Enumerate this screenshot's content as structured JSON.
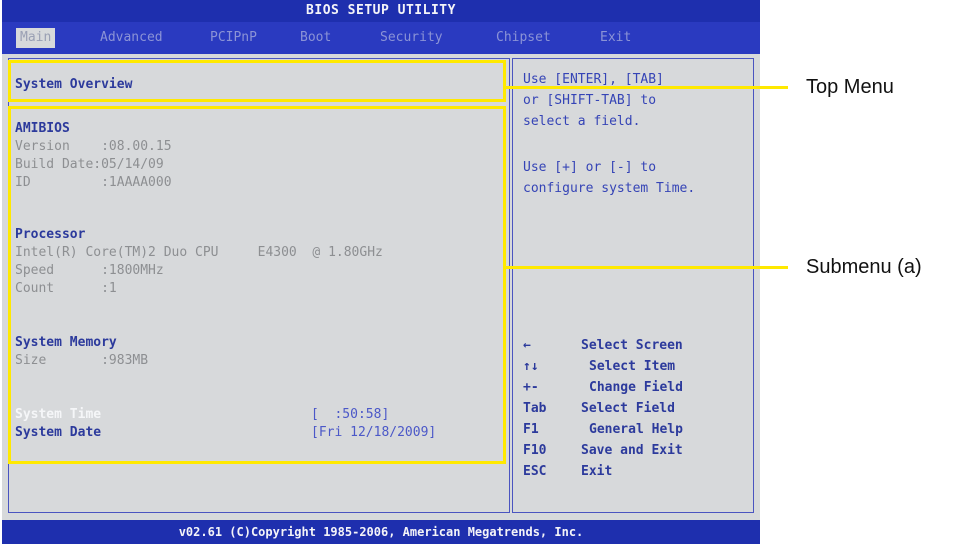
{
  "title": "BIOS SETUP UTILITY",
  "menu": {
    "items": [
      "Main",
      "Advanced",
      "PCIPnP",
      "Boot",
      "Security",
      "Chipset",
      "Exit"
    ]
  },
  "overview_header": "System Overview",
  "amibios": {
    "label": "AMIBIOS",
    "version": "Version    :08.00.15",
    "build_date": "Build Date:05/14/09",
    "id": "ID         :1AAAA000"
  },
  "processor": {
    "label": "Processor",
    "cpu": "Intel(R) Core(TM)2 Duo CPU     E4300  @ 1.80GHz",
    "speed": "Speed      :1800MHz",
    "count": "Count      :1"
  },
  "memory": {
    "label": "System Memory",
    "size": "Size       :983MB"
  },
  "time": {
    "label": "System Time",
    "value": "[  :50:58]"
  },
  "date": {
    "label": "System Date",
    "value": "[Fri 12/18/2009]"
  },
  "help": {
    "line1": "Use [ENTER], [TAB]",
    "line2": "or [SHIFT-TAB] to",
    "line3": "select a field.",
    "line4": "Use [+] or [-] to",
    "line5": "configure system Time."
  },
  "keys": [
    {
      "key": "←",
      "desc": "Select Screen"
    },
    {
      "key": "↑↓",
      "desc": "Select Item"
    },
    {
      "key": "+-",
      "desc": "Change Field"
    },
    {
      "key": "Tab",
      "desc": "Select Field"
    },
    {
      "key": "F1",
      "desc": "General Help"
    },
    {
      "key": "F10",
      "desc": "Save and Exit"
    },
    {
      "key": "ESC",
      "desc": "Exit"
    }
  ],
  "footer": "v02.61 (C)Copyright 1985-2006, American Megatrends, Inc.",
  "annotations": {
    "top_menu": "Top Menu",
    "submenu": "Submenu  (a)"
  },
  "colors": {
    "bios_blue": "#1e2fae",
    "panel_gray": "#d7d9db",
    "annotation_yellow": "#ffe900"
  }
}
